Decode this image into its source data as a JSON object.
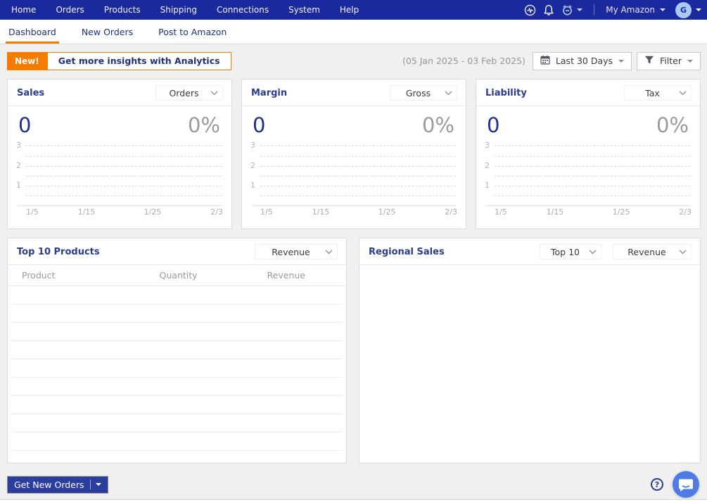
{
  "navbar": {
    "items": [
      "Home",
      "Orders",
      "Products",
      "Shipping",
      "Connections",
      "System",
      "Help"
    ],
    "icons": [
      "pulse-icon",
      "bell-icon",
      "alarm-icon"
    ],
    "account_label": "My Amazon",
    "avatar_initial": "G"
  },
  "tabs": [
    {
      "label": "Dashboard",
      "active": true
    },
    {
      "label": "New Orders",
      "active": false
    },
    {
      "label": "Post to Amazon",
      "active": false
    }
  ],
  "toolbar": {
    "new_badge": "New!",
    "analytics_button": "Get more insights with Analytics",
    "date_range": "(05 Jan 2025 - 03 Feb 2025)",
    "period_select": "Last 30 Days",
    "filter_button": "Filter"
  },
  "kpi_cards": [
    {
      "title": "Sales",
      "select": "Orders",
      "value": "0",
      "percent": "0%"
    },
    {
      "title": "Margin",
      "select": "Gross",
      "value": "0",
      "percent": "0%"
    },
    {
      "title": "Liability",
      "select": "Tax",
      "value": "0",
      "percent": "0%"
    }
  ],
  "chart_data": {
    "type": "line",
    "title": "KPI mini chart (repeated for Sales, Margin, Liability)",
    "x_labels": [
      "1/5",
      "1/15",
      "1/25",
      "2/3"
    ],
    "y_ticks": [
      3,
      2,
      1
    ],
    "gridline_values": [
      3,
      2.5,
      2,
      1.5,
      1,
      0.5
    ],
    "ylim": [
      0,
      3.3
    ],
    "grid": "dashed horizontal",
    "series": [],
    "note": "charts are empty - no data plotted, value 0 and 0% shown"
  },
  "products_card": {
    "title": "Top 10 Products",
    "select": "Revenue",
    "columns": [
      "Product",
      "Quantity",
      "Revenue"
    ],
    "rows": [],
    "row_count": 10
  },
  "regional_card": {
    "title": "Regional Sales",
    "selects": [
      "Top 10",
      "Revenue"
    ]
  },
  "footer": {
    "get_orders_button": "Get New Orders",
    "help_icon": "question-mark-icon",
    "chat_icon": "chat-bubble-icon"
  },
  "colors": {
    "navbar_bg": "#1A2A9E",
    "accent_orange": "#F57C01",
    "title_navy": "#2B3C8C",
    "value_navy": "#1B2F96",
    "muted_gray": "#9B9B9B",
    "page_bg": "#F0F0F1",
    "chat_blue": "#4D7BE8"
  }
}
